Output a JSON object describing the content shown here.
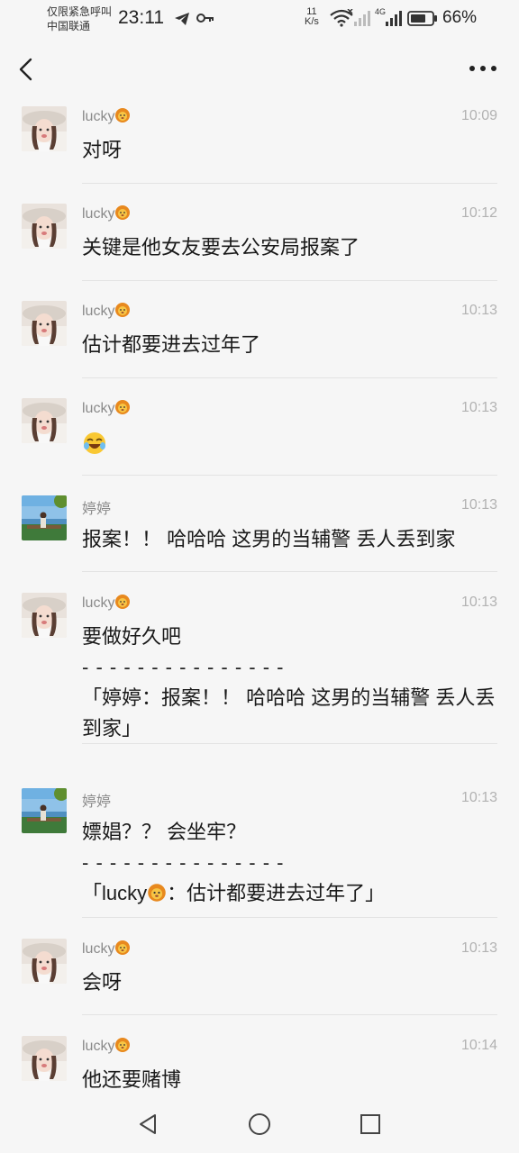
{
  "status_bar": {
    "carrier_line1": "仅限紧急呼叫",
    "carrier_line2": "中国联通",
    "time": "23:11",
    "net_speed_value": "11",
    "net_speed_unit": "K/s",
    "network_type": "4G",
    "battery": "66%"
  },
  "header": {
    "back_icon": "chevron-left-icon",
    "more_icon": "more-horizontal-icon"
  },
  "messages": [
    {
      "sender": "lucky",
      "sender_avatar": "lucky-avatar",
      "time": "10:09",
      "text": "对呀"
    },
    {
      "sender": "lucky",
      "sender_avatar": "lucky-avatar",
      "time": "10:12",
      "text": "关键是他女友要去公安局报案了"
    },
    {
      "sender": "lucky",
      "sender_avatar": "lucky-avatar",
      "time": "10:13",
      "text": "估计都要进去过年了"
    },
    {
      "sender": "lucky",
      "sender_avatar": "lucky-avatar",
      "time": "10:13",
      "text": "",
      "emoji": "laughing-emoji"
    },
    {
      "sender": "婷婷",
      "sender_avatar": "tingting-avatar",
      "time": "10:13",
      "text": "报案！！ 哈哈哈 这男的当辅警 丢人丢到家"
    },
    {
      "sender": "lucky",
      "sender_avatar": "lucky-avatar",
      "time": "10:13",
      "text": "要做好久吧",
      "quote_separator": "- - - - - - - - - - - - - - -",
      "quote": "「婷婷：报案！！ 哈哈哈 这男的当辅警 丢人丢到家」"
    },
    {
      "sender": "婷婷",
      "sender_avatar": "tingting-avatar",
      "time": "10:13",
      "text": "嫖娼？？ 会坐牢？",
      "quote_separator": "- - - - - - - - - - - - - - -",
      "quote_prefix": "「lucky",
      "quote": "：估计都要进去过年了」"
    },
    {
      "sender": "lucky",
      "sender_avatar": "lucky-avatar",
      "time": "10:13",
      "text": "会呀"
    },
    {
      "sender": "lucky",
      "sender_avatar": "lucky-avatar",
      "time": "10:14",
      "text": "他还要赌博"
    }
  ],
  "nav_bar": {
    "back": "triangle-back-icon",
    "home": "circle-home-icon",
    "recents": "square-recents-icon"
  },
  "colors": {
    "background": "#f6f6f6",
    "name_text": "#8a8a8a",
    "time_text": "#b2b2b2",
    "divider": "#e3e3e3"
  }
}
